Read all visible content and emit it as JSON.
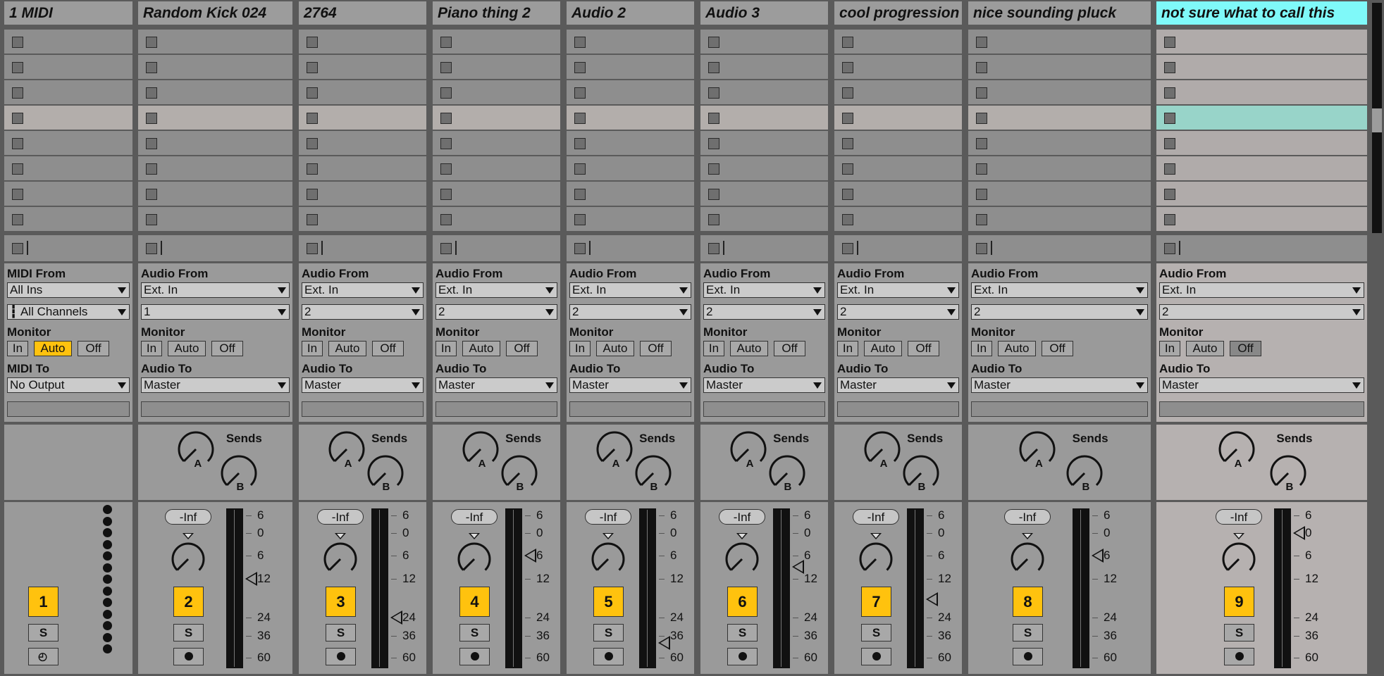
{
  "tracks": [
    {
      "name": "1 MIDI",
      "type": "midi",
      "number": "1",
      "from_label": "MIDI From",
      "from_value": "All Ins",
      "channel_value": "All Channels",
      "monitor_label": "Monitor",
      "monitor": [
        "In",
        "Auto",
        "Off"
      ],
      "monitor_active": "Auto",
      "to_label": "MIDI To",
      "to_value": "No Output",
      "selected": false
    },
    {
      "name": "Random Kick 024",
      "type": "audio",
      "number": "2",
      "from_label": "Audio From",
      "from_value": "Ext. In",
      "channel_value": "1",
      "monitor_label": "Monitor",
      "monitor": [
        "In",
        "Auto",
        "Off"
      ],
      "monitor_active": "",
      "to_label": "Audio To",
      "to_value": "Master",
      "selected": false,
      "sends_label": "Sends",
      "send_a": "A",
      "send_b": "B",
      "volume": "-Inf",
      "fader_level_db": "-12",
      "solo": "S"
    },
    {
      "name": "2764",
      "type": "audio",
      "number": "3",
      "from_label": "Audio From",
      "from_value": "Ext. In",
      "channel_value": "2",
      "monitor_label": "Monitor",
      "monitor": [
        "In",
        "Auto",
        "Off"
      ],
      "monitor_active": "",
      "to_label": "Audio To",
      "to_value": "Master",
      "selected": false,
      "sends_label": "Sends",
      "send_a": "A",
      "send_b": "B",
      "volume": "-Inf",
      "fader_level_db": "-24",
      "solo": "S"
    },
    {
      "name": "Piano thing 2",
      "type": "audio",
      "number": "4",
      "from_label": "Audio From",
      "from_value": "Ext. In",
      "channel_value": "2",
      "monitor_label": "Monitor",
      "monitor": [
        "In",
        "Auto",
        "Off"
      ],
      "monitor_active": "",
      "to_label": "Audio To",
      "to_value": "Master",
      "selected": false,
      "sends_label": "Sends",
      "send_a": "A",
      "send_b": "B",
      "volume": "-Inf",
      "fader_level_db": "-6",
      "solo": "S"
    },
    {
      "name": "Audio 2",
      "type": "audio",
      "number": "5",
      "from_label": "Audio From",
      "from_value": "Ext. In",
      "channel_value": "2",
      "monitor_label": "Monitor",
      "monitor": [
        "In",
        "Auto",
        "Off"
      ],
      "monitor_active": "",
      "to_label": "Audio To",
      "to_value": "Master",
      "selected": false,
      "sends_label": "Sends",
      "send_a": "A",
      "send_b": "B",
      "volume": "-Inf",
      "fader_level_db": "-40",
      "solo": "S"
    },
    {
      "name": "Audio 3",
      "type": "audio",
      "number": "6",
      "from_label": "Audio From",
      "from_value": "Ext. In",
      "channel_value": "2",
      "monitor_label": "Monitor",
      "monitor": [
        "In",
        "Auto",
        "Off"
      ],
      "monitor_active": "",
      "to_label": "Audio To",
      "to_value": "Master",
      "selected": false,
      "sends_label": "Sends",
      "send_a": "A",
      "send_b": "B",
      "volume": "-Inf",
      "fader_level_db": "-9",
      "solo": "S"
    },
    {
      "name": "cool progression",
      "type": "audio",
      "number": "7",
      "from_label": "Audio From",
      "from_value": "Ext. In",
      "channel_value": "2",
      "monitor_label": "Monitor",
      "monitor": [
        "In",
        "Auto",
        "Off"
      ],
      "monitor_active": "",
      "to_label": "Audio To",
      "to_value": "Master",
      "selected": false,
      "sends_label": "Sends",
      "send_a": "A",
      "send_b": "B",
      "volume": "-Inf",
      "fader_level_db": "-18",
      "solo": "S"
    },
    {
      "name": "nice sounding pluck",
      "type": "audio",
      "number": "8",
      "from_label": "Audio From",
      "from_value": "Ext. In",
      "channel_value": "2",
      "monitor_label": "Monitor",
      "monitor": [
        "In",
        "Auto",
        "Off"
      ],
      "monitor_active": "",
      "to_label": "Audio To",
      "to_value": "Master",
      "selected": false,
      "sends_label": "Sends",
      "send_a": "A",
      "send_b": "B",
      "volume": "-Inf",
      "fader_level_db": "-6",
      "solo": "S"
    },
    {
      "name": "not sure what to call this",
      "type": "audio",
      "number": "9",
      "from_label": "Audio From",
      "from_value": "Ext. In",
      "channel_value": "2",
      "monitor_label": "Monitor",
      "monitor": [
        "In",
        "Auto",
        "Off"
      ],
      "monitor_active": "Off",
      "to_label": "Audio To",
      "to_value": "Master",
      "selected": true,
      "sends_label": "Sends",
      "send_a": "A",
      "send_b": "B",
      "volume": "-Inf",
      "fader_level_db": "0",
      "solo": "S"
    }
  ],
  "meter_scale": [
    "6",
    "0",
    "6",
    "12",
    "24",
    "36",
    "60"
  ],
  "midi_solo": "S",
  "colors": {
    "track_number": "#ffc20e",
    "monitor_active": "#ffc20e",
    "selected_header": "#7ff9f9",
    "selected_slot": "#98d4c9"
  }
}
